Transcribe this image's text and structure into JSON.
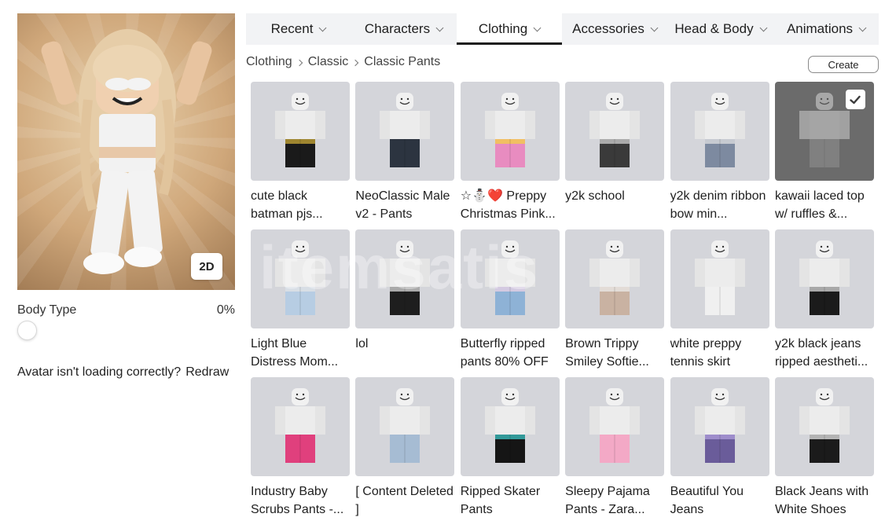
{
  "tabs": [
    {
      "label": "Recent",
      "active": false
    },
    {
      "label": "Characters",
      "active": false
    },
    {
      "label": "Clothing",
      "active": true
    },
    {
      "label": "Accessories",
      "active": false
    },
    {
      "label": "Head & Body",
      "active": false
    },
    {
      "label": "Animations",
      "active": false
    }
  ],
  "breadcrumb": [
    "Clothing",
    "Classic",
    "Classic Pants"
  ],
  "create_label": "Create",
  "avatar": {
    "view_toggle": "2D"
  },
  "body_type": {
    "label": "Body Type",
    "value": "0%"
  },
  "redraw": {
    "prompt": "Avatar isn't loading correctly?",
    "link": "Redraw"
  },
  "watermark": "itemsatis",
  "items": [
    {
      "name": "cute black batman pjs...",
      "pants": "#1a1a1a",
      "accent": "#d9b53a",
      "selected": false
    },
    {
      "name": "NeoClassic Male v2 - Pants",
      "pants": "#2c3440",
      "accent": "#2c3440",
      "selected": false
    },
    {
      "name": "☆⛄❤️ Preppy Christmas Pink...",
      "pants": "#e88cc0",
      "accent": "#f5d43c",
      "selected": false
    },
    {
      "name": "y2k school",
      "pants": "#3a3a3a",
      "accent": "#dcdcdc",
      "selected": false
    },
    {
      "name": "y2k denim ribbon bow min...",
      "pants": "#7d8aa0",
      "accent": "#e6e6e6",
      "selected": false
    },
    {
      "name": "kawaii laced top w/ ruffles &...",
      "pants": "#9a9a9a",
      "accent": "#9a9a9a",
      "selected": true
    },
    {
      "name": "Light Blue Distress Mom...",
      "pants": "#b7cde3",
      "accent": "#e6e6e6",
      "selected": false
    },
    {
      "name": "lol",
      "pants": "#1e1e1e",
      "accent": "#e6e6e6",
      "selected": false
    },
    {
      "name": "Butterfly ripped pants 80% OFF",
      "pants": "#8eb2d6",
      "accent": "#f2d4e6",
      "selected": false
    },
    {
      "name": "Brown Trippy Smiley Softie...",
      "pants": "#c9b2a2",
      "accent": "#eeeeee",
      "selected": false
    },
    {
      "name": "white preppy tennis skirt",
      "pants": "#f0f0f0",
      "accent": "#f0f0f0",
      "selected": false
    },
    {
      "name": "y2k black jeans ripped aestheti...",
      "pants": "#1b1b1b",
      "accent": "#e6e6e6",
      "selected": false
    },
    {
      "name": "Industry Baby Scrubs Pants -...",
      "pants": "#e0407d",
      "accent": "#e0407d",
      "selected": false
    },
    {
      "name": "[ Content Deleted ]",
      "pants": "#a6bcd3",
      "accent": "#a6bcd3",
      "selected": false
    },
    {
      "name": "Ripped Skater Pants",
      "pants": "#151515",
      "accent": "#3fd2d2",
      "selected": false
    },
    {
      "name": "Sleepy Pajama Pants - Zara...",
      "pants": "#f3a9c6",
      "accent": "#f3a9c6",
      "selected": false
    },
    {
      "name": "Beautiful You Jeans",
      "pants": "#6a5c9a",
      "accent": "#b5a3e0",
      "selected": false
    },
    {
      "name": "Black Jeans with White Shoes",
      "pants": "#1b1b1b",
      "accent": "#f5f5f5",
      "selected": false
    }
  ]
}
